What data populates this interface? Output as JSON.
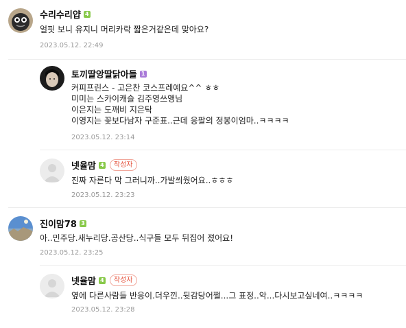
{
  "comments": [
    {
      "nickname": "수리수리얍",
      "level": "4",
      "text": [
        "얼핏 보니 유지니 머리카락 짧은거같은데 맞아요?"
      ],
      "date": "2023.05.12. 22:49"
    },
    {
      "nickname": "토끼딸앙딸닭아들",
      "level": "1",
      "text": [
        "커피프린스 - 고은찬 코스프레예요^^ ㅎㅎ",
        "미미는 스카이캐슬 김주영쓰앵님",
        "이은지는 도깨비 지은탁",
        "이영지는 꽃보다남자 구준표..근데 응팔의 정봉이엄마..ㅋㅋㅋㅋ"
      ],
      "date": "2023.05.12. 23:14"
    },
    {
      "nickname": "넷율맘",
      "level": "4",
      "author_tag": "작성자",
      "text": [
        "진짜 자른다 막 그러니까..가발씌웠어요..ㅎㅎㅎ"
      ],
      "date": "2023.05.12. 23:23"
    },
    {
      "nickname": "진이맘78",
      "level": "3",
      "text": [
        "아..민주당.새누리당.공산당..식구들 모두 뒤집어 졌어요!"
      ],
      "date": "2023.05.12. 23:25"
    },
    {
      "nickname": "넷율맘",
      "level": "4",
      "author_tag": "작성자",
      "text": [
        "옆에 다른사람들 반응이.더우낀..뒷감당어쩔...그 표정..악...다시보고싶네여..ㅋㅋㅋㅋ"
      ],
      "date": "2023.05.12. 23:28"
    }
  ],
  "colors": {
    "level_green": "#88c94a",
    "level_purple": "#a97ad8",
    "author_tag": "#e5533d",
    "date": "#9a9a9a"
  }
}
